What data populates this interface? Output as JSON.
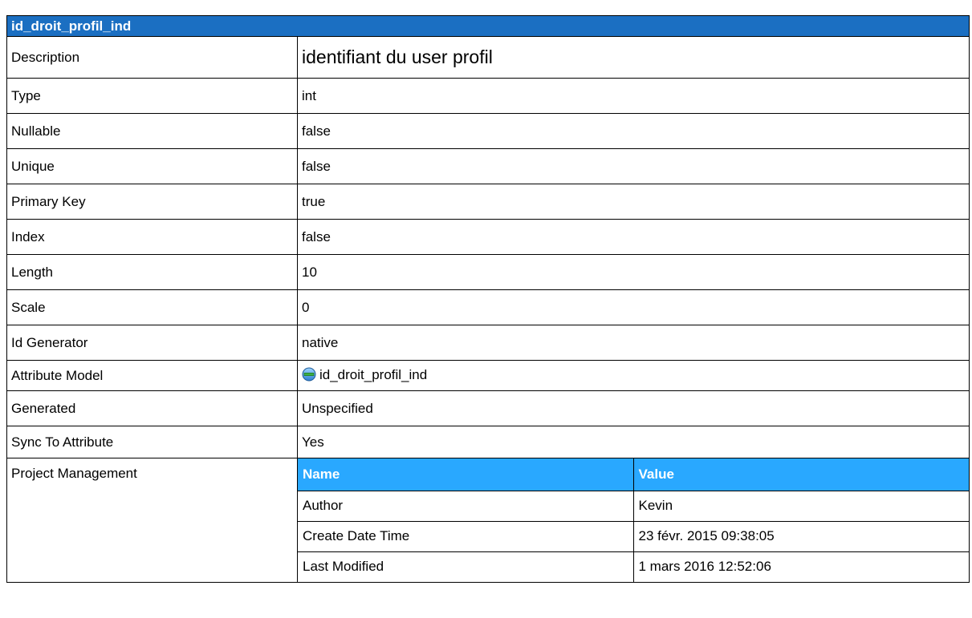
{
  "title": "id_droit_profil_ind",
  "rows": {
    "description": {
      "label": "Description",
      "value": "identifiant du user profil"
    },
    "type": {
      "label": "Type",
      "value": "int"
    },
    "nullable": {
      "label": "Nullable",
      "value": "false"
    },
    "unique": {
      "label": "Unique",
      "value": "false"
    },
    "primary_key": {
      "label": "Primary Key",
      "value": "true"
    },
    "index": {
      "label": "Index",
      "value": "false"
    },
    "length": {
      "label": "Length",
      "value": "10"
    },
    "scale": {
      "label": "Scale",
      "value": "0"
    },
    "id_generator": {
      "label": "Id Generator",
      "value": "native"
    },
    "attribute_model": {
      "label": "Attribute Model",
      "value": "id_droit_profil_ind",
      "icon": "attribute-model-icon"
    },
    "generated": {
      "label": "Generated",
      "value": "Unspecified"
    },
    "sync_to_attribute": {
      "label": "Sync To Attribute",
      "value": "Yes"
    }
  },
  "project_management": {
    "label": "Project Management",
    "headers": [
      "Name",
      "Value"
    ],
    "rows": [
      [
        "Author",
        "Kevin"
      ],
      [
        "Create Date Time",
        "23 févr. 2015 09:38:05"
      ],
      [
        "Last Modified",
        "1 mars 2016 12:52:06"
      ]
    ]
  },
  "colors": {
    "title_bg": "#1b6fc2",
    "subheader_bg": "#29a8ff"
  }
}
